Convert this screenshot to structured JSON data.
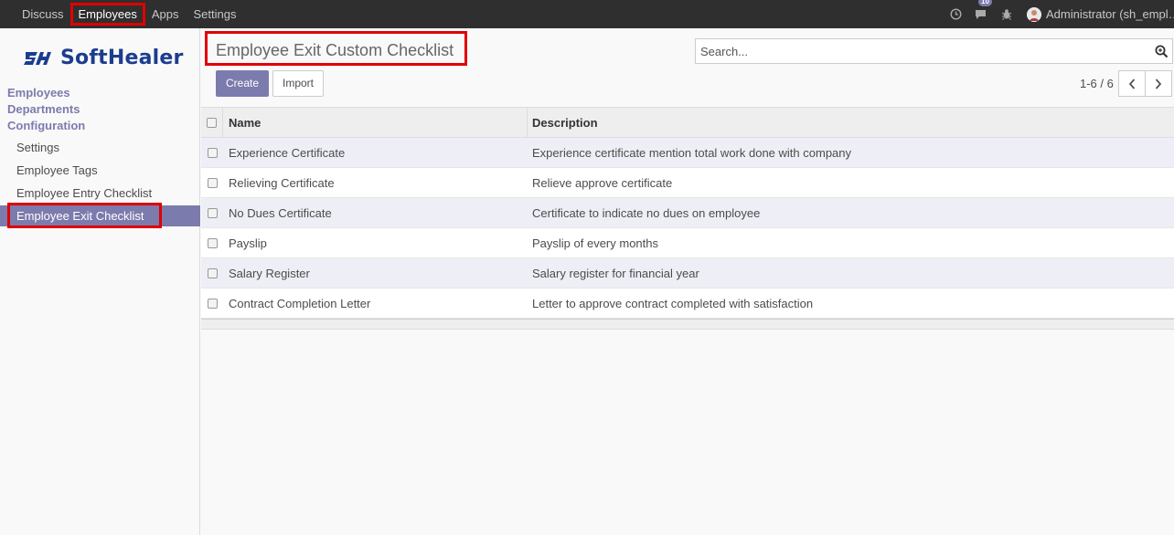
{
  "topbar": {
    "nav": [
      "Discuss",
      "Employees",
      "Apps",
      "Settings"
    ],
    "active_nav": "Employees",
    "messages_badge": "10",
    "user": "Administrator (sh_empl…"
  },
  "sidebar": {
    "logo": "SoftHealer",
    "sections": [
      "Employees",
      "Departments",
      "Configuration"
    ],
    "config_items": [
      "Settings",
      "Employee Tags",
      "Employee Entry Checklist",
      "Employee Exit Checklist"
    ],
    "active_item": "Employee Exit Checklist"
  },
  "header": {
    "title": "Employee Exit Custom Checklist",
    "search_placeholder": "Search...",
    "create_label": "Create",
    "import_label": "Import",
    "pager": "1-6 / 6"
  },
  "table": {
    "columns": [
      "Name",
      "Description"
    ],
    "rows": [
      {
        "name": "Experience Certificate",
        "description": "Experience certificate mention total work done with company"
      },
      {
        "name": "Relieving Certificate",
        "description": "Relieve approve certificate"
      },
      {
        "name": "No Dues Certificate",
        "description": "Certificate to indicate no dues on employee"
      },
      {
        "name": "Payslip",
        "description": "Payslip of every months"
      },
      {
        "name": "Salary Register",
        "description": "Salary register for financial year"
      },
      {
        "name": "Contract Completion Letter",
        "description": "Letter to approve contract completed with satisfaction"
      }
    ]
  },
  "colors": {
    "accent": "#7c7bad",
    "highlight": "#e00000",
    "topbar": "#2f2f2f"
  }
}
